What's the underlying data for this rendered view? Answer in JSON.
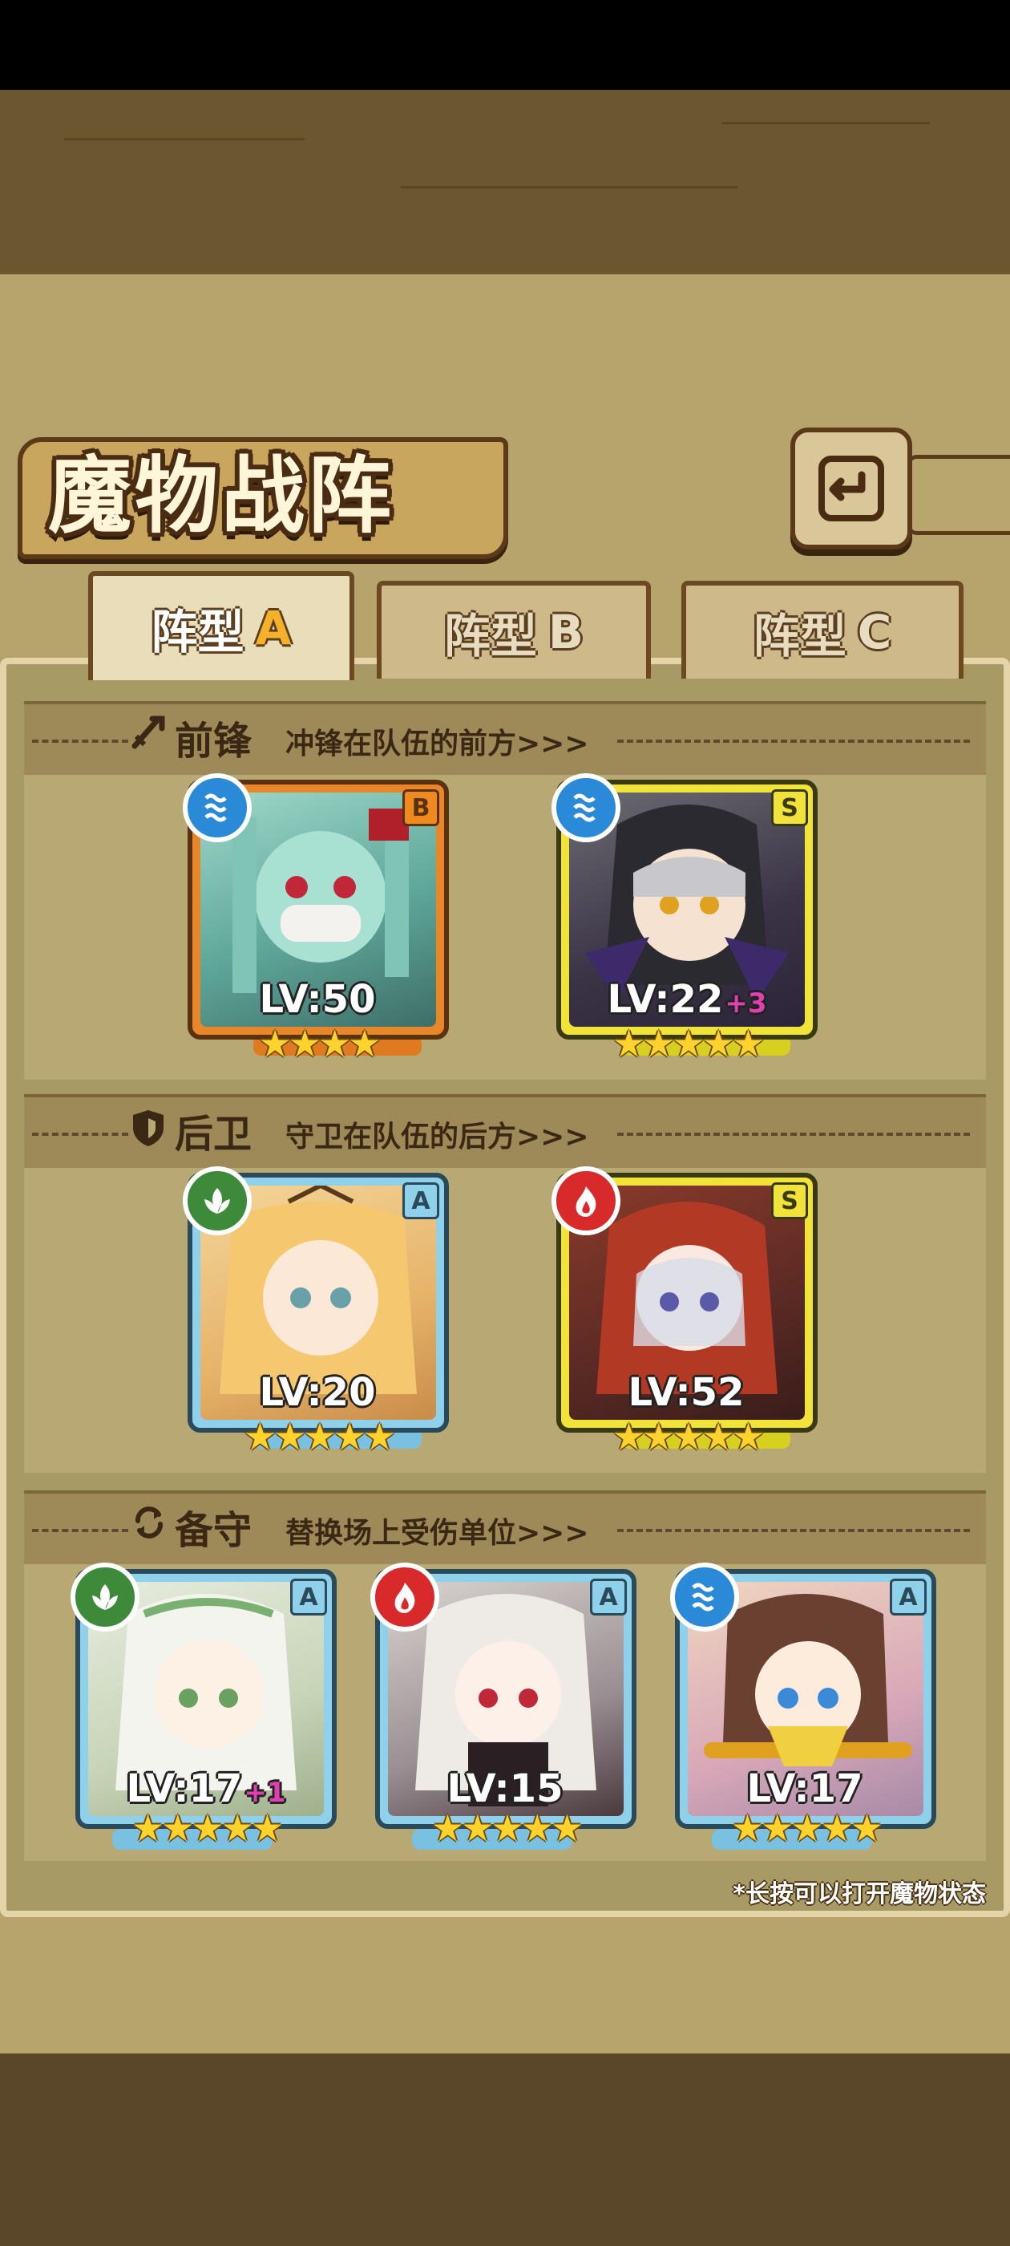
{
  "header": {
    "title": "魔物战阵",
    "back_icon": "back-arrow-icon"
  },
  "tabs": [
    {
      "label": "阵型",
      "suffix": "A",
      "active": true
    },
    {
      "label": "阵型",
      "suffix": "B",
      "active": false
    },
    {
      "label": "阵型",
      "suffix": "C",
      "active": false
    }
  ],
  "sections": {
    "front": {
      "icon": "sword-icon",
      "title": "前锋",
      "desc": "冲锋在队伍的前方>>>"
    },
    "rear": {
      "icon": "shield-icon",
      "title": "后卫",
      "desc": "守卫在队伍的后方>>>"
    },
    "reserve": {
      "icon": "swap-icon",
      "title": "备守",
      "desc": "替换场上受伤单位>>>"
    }
  },
  "cards": {
    "front1": {
      "element": "water",
      "rarity": "B",
      "level": "LV:50",
      "plus": "",
      "stars": "★★★★"
    },
    "front2": {
      "element": "water",
      "rarity": "S",
      "level": "LV:22",
      "plus": "+3",
      "stars": "★★★★★"
    },
    "rear1": {
      "element": "wood",
      "rarity": "A",
      "level": "LV:20",
      "plus": "",
      "stars": "★★★★★"
    },
    "rear2": {
      "element": "fire",
      "rarity": "S",
      "level": "LV:52",
      "plus": "",
      "stars": "★★★★★"
    },
    "res1": {
      "element": "wood",
      "rarity": "A",
      "level": "LV:17",
      "plus": "+1",
      "stars": "★★★★★"
    },
    "res2": {
      "element": "fire",
      "rarity": "A",
      "level": "LV:15",
      "plus": "",
      "stars": "★★★★★"
    },
    "res3": {
      "element": "water",
      "rarity": "A",
      "level": "LV:17",
      "plus": "",
      "stars": "★★★★★"
    }
  },
  "footer": {
    "hint": "*长按可以打开魔物状态"
  },
  "colors": {
    "water": "#2a8ad8",
    "wood": "#3d8a3a",
    "fire": "#d82a2a",
    "rarityS": "#f2e33a",
    "rarityB": "#f08a1e",
    "rarityA": "#8fd0ea"
  }
}
